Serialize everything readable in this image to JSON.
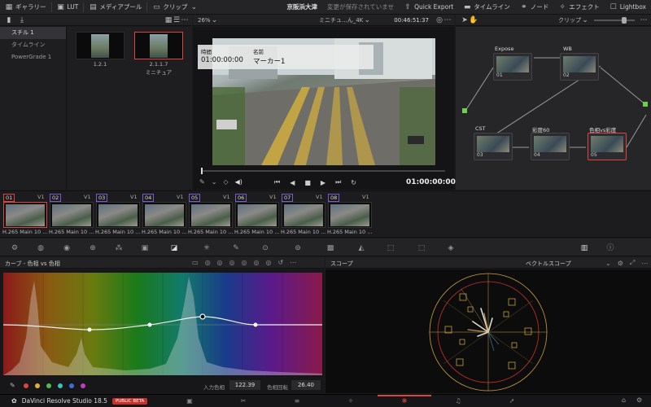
{
  "topbar": {
    "gallery": "ギャラリー",
    "lut": "LUT",
    "media_pool": "メディアプール",
    "clip": "クリップ",
    "project": "京阪浜大津",
    "unsaved": "変更が保存されていませ",
    "quick_export": "Quick Export",
    "timeline": "タイムライン",
    "node": "ノード",
    "effects": "エフェクト",
    "lightbox": "Lightbox"
  },
  "gallery": {
    "items": [
      {
        "label": "スチル 1",
        "selected": true
      },
      {
        "label": "タイムライン",
        "selected": false
      },
      {
        "label": "PowerGrade 1",
        "selected": false
      }
    ],
    "stills": [
      {
        "label": "1.2.1",
        "sublabel": ""
      },
      {
        "label": "2.1.1.7",
        "sublabel": "ミニチュア"
      }
    ]
  },
  "viewer": {
    "zoom": "26%",
    "clip_name": "ミニチュ...ん_4K",
    "timecode_top": "00:46:51:37",
    "info_time_label": "時間",
    "info_name_label": "名前",
    "info_time": "01:00:00:00",
    "info_name": "マーカー1",
    "timecode": "01:00:00:00"
  },
  "nodes": {
    "mode": "クリップ",
    "list": [
      {
        "num": "01",
        "label": "Expose"
      },
      {
        "num": "02",
        "label": "WB"
      },
      {
        "num": "03",
        "label": "CST"
      },
      {
        "num": "04",
        "label": "彩度60"
      },
      {
        "num": "05",
        "label": "色相vs彩度"
      }
    ]
  },
  "clips": [
    {
      "num": "01",
      "track": "V1",
      "label": "H.265 Main 10 ..."
    },
    {
      "num": "02",
      "track": "V1",
      "label": "H.265 Main 10 ..."
    },
    {
      "num": "03",
      "track": "V1",
      "label": "H.265 Main 10 ..."
    },
    {
      "num": "04",
      "track": "V1",
      "label": "H.265 Main 10 ..."
    },
    {
      "num": "05",
      "track": "V1",
      "label": "H.265 Main 10 ..."
    },
    {
      "num": "06",
      "track": "V1",
      "label": "H.265 Main 10 ..."
    },
    {
      "num": "07",
      "track": "V1",
      "label": "H.265 Main 10 ..."
    },
    {
      "num": "08",
      "track": "V1",
      "label": "H.265 Main 10 ..."
    }
  ],
  "curves": {
    "title": "カーブ - 色相 vs 色相",
    "input_hue_label": "入力色相",
    "input_hue": "122.39",
    "hue_rotate_label": "色相回転",
    "hue_rotate": "26.40"
  },
  "scope": {
    "title": "スコープ",
    "mode": "ベクトルスコープ"
  },
  "footer": {
    "app": "DaVinci Resolve Studio 18.5",
    "badge": "PUBLIC BETA"
  },
  "colors": {
    "accent_red": "#e0443c",
    "node_clip_border": "#7a5ad0"
  }
}
